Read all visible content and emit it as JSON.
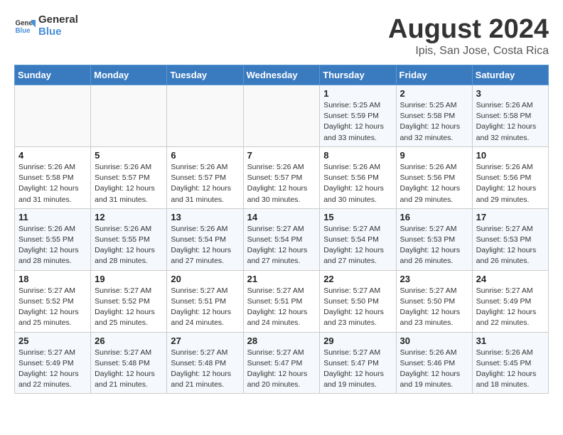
{
  "header": {
    "logo_general": "General",
    "logo_blue": "Blue",
    "title": "August 2024",
    "subtitle": "Ipis, San Jose, Costa Rica"
  },
  "calendar": {
    "days_of_week": [
      "Sunday",
      "Monday",
      "Tuesday",
      "Wednesday",
      "Thursday",
      "Friday",
      "Saturday"
    ],
    "weeks": [
      [
        {
          "day": "",
          "info": ""
        },
        {
          "day": "",
          "info": ""
        },
        {
          "day": "",
          "info": ""
        },
        {
          "day": "",
          "info": ""
        },
        {
          "day": "1",
          "info": "Sunrise: 5:25 AM\nSunset: 5:59 PM\nDaylight: 12 hours and 33 minutes."
        },
        {
          "day": "2",
          "info": "Sunrise: 5:25 AM\nSunset: 5:58 PM\nDaylight: 12 hours and 32 minutes."
        },
        {
          "day": "3",
          "info": "Sunrise: 5:26 AM\nSunset: 5:58 PM\nDaylight: 12 hours and 32 minutes."
        }
      ],
      [
        {
          "day": "4",
          "info": "Sunrise: 5:26 AM\nSunset: 5:58 PM\nDaylight: 12 hours and 31 minutes."
        },
        {
          "day": "5",
          "info": "Sunrise: 5:26 AM\nSunset: 5:57 PM\nDaylight: 12 hours and 31 minutes."
        },
        {
          "day": "6",
          "info": "Sunrise: 5:26 AM\nSunset: 5:57 PM\nDaylight: 12 hours and 31 minutes."
        },
        {
          "day": "7",
          "info": "Sunrise: 5:26 AM\nSunset: 5:57 PM\nDaylight: 12 hours and 30 minutes."
        },
        {
          "day": "8",
          "info": "Sunrise: 5:26 AM\nSunset: 5:56 PM\nDaylight: 12 hours and 30 minutes."
        },
        {
          "day": "9",
          "info": "Sunrise: 5:26 AM\nSunset: 5:56 PM\nDaylight: 12 hours and 29 minutes."
        },
        {
          "day": "10",
          "info": "Sunrise: 5:26 AM\nSunset: 5:56 PM\nDaylight: 12 hours and 29 minutes."
        }
      ],
      [
        {
          "day": "11",
          "info": "Sunrise: 5:26 AM\nSunset: 5:55 PM\nDaylight: 12 hours and 28 minutes."
        },
        {
          "day": "12",
          "info": "Sunrise: 5:26 AM\nSunset: 5:55 PM\nDaylight: 12 hours and 28 minutes."
        },
        {
          "day": "13",
          "info": "Sunrise: 5:26 AM\nSunset: 5:54 PM\nDaylight: 12 hours and 27 minutes."
        },
        {
          "day": "14",
          "info": "Sunrise: 5:27 AM\nSunset: 5:54 PM\nDaylight: 12 hours and 27 minutes."
        },
        {
          "day": "15",
          "info": "Sunrise: 5:27 AM\nSunset: 5:54 PM\nDaylight: 12 hours and 27 minutes."
        },
        {
          "day": "16",
          "info": "Sunrise: 5:27 AM\nSunset: 5:53 PM\nDaylight: 12 hours and 26 minutes."
        },
        {
          "day": "17",
          "info": "Sunrise: 5:27 AM\nSunset: 5:53 PM\nDaylight: 12 hours and 26 minutes."
        }
      ],
      [
        {
          "day": "18",
          "info": "Sunrise: 5:27 AM\nSunset: 5:52 PM\nDaylight: 12 hours and 25 minutes."
        },
        {
          "day": "19",
          "info": "Sunrise: 5:27 AM\nSunset: 5:52 PM\nDaylight: 12 hours and 25 minutes."
        },
        {
          "day": "20",
          "info": "Sunrise: 5:27 AM\nSunset: 5:51 PM\nDaylight: 12 hours and 24 minutes."
        },
        {
          "day": "21",
          "info": "Sunrise: 5:27 AM\nSunset: 5:51 PM\nDaylight: 12 hours and 24 minutes."
        },
        {
          "day": "22",
          "info": "Sunrise: 5:27 AM\nSunset: 5:50 PM\nDaylight: 12 hours and 23 minutes."
        },
        {
          "day": "23",
          "info": "Sunrise: 5:27 AM\nSunset: 5:50 PM\nDaylight: 12 hours and 23 minutes."
        },
        {
          "day": "24",
          "info": "Sunrise: 5:27 AM\nSunset: 5:49 PM\nDaylight: 12 hours and 22 minutes."
        }
      ],
      [
        {
          "day": "25",
          "info": "Sunrise: 5:27 AM\nSunset: 5:49 PM\nDaylight: 12 hours and 22 minutes."
        },
        {
          "day": "26",
          "info": "Sunrise: 5:27 AM\nSunset: 5:48 PM\nDaylight: 12 hours and 21 minutes."
        },
        {
          "day": "27",
          "info": "Sunrise: 5:27 AM\nSunset: 5:48 PM\nDaylight: 12 hours and 21 minutes."
        },
        {
          "day": "28",
          "info": "Sunrise: 5:27 AM\nSunset: 5:47 PM\nDaylight: 12 hours and 20 minutes."
        },
        {
          "day": "29",
          "info": "Sunrise: 5:27 AM\nSunset: 5:47 PM\nDaylight: 12 hours and 19 minutes."
        },
        {
          "day": "30",
          "info": "Sunrise: 5:26 AM\nSunset: 5:46 PM\nDaylight: 12 hours and 19 minutes."
        },
        {
          "day": "31",
          "info": "Sunrise: 5:26 AM\nSunset: 5:45 PM\nDaylight: 12 hours and 18 minutes."
        }
      ]
    ]
  }
}
